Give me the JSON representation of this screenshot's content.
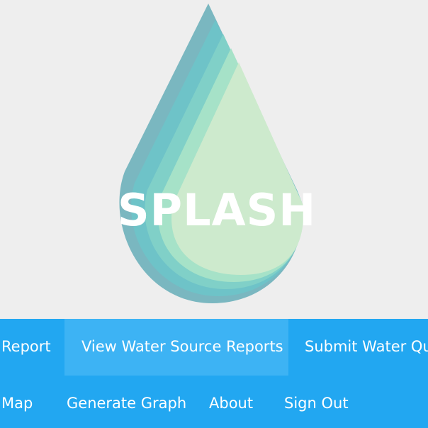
{
  "brand": {
    "name": "SPLASH"
  },
  "colors": {
    "background": "#eeeeee",
    "nav": "#22a7f1",
    "nav_active": "#3db3f4",
    "nav_text": "#ffffff",
    "drop_layers": [
      "#7ab7c0",
      "#6ec3c8",
      "#80d0c8",
      "#a6e2c8",
      "#cdeacd"
    ]
  },
  "nav": {
    "row1": [
      {
        "label": "Report",
        "active": false
      },
      {
        "label": "View Water Source Reports",
        "active": true
      },
      {
        "label": "Submit Water Qua",
        "active": false
      }
    ],
    "row2": [
      {
        "label": "Map",
        "active": false
      },
      {
        "label": "Generate Graph",
        "active": false
      },
      {
        "label": "About",
        "active": false
      },
      {
        "label": "Sign Out",
        "active": false
      }
    ]
  }
}
